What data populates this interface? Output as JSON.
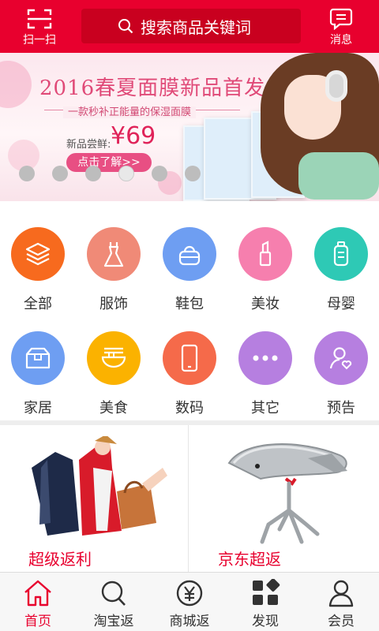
{
  "header": {
    "scan_label": "扫一扫",
    "search_placeholder": "搜索商品关键词",
    "message_label": "消息"
  },
  "banner": {
    "title": "2016春夏面膜新品首发",
    "subtitle": "一款秒补正能量的保湿面膜",
    "price_label": "新品尝鲜:",
    "price": "¥69",
    "cta": "点击了解>>",
    "slide_count": 6,
    "active_slide": 4
  },
  "categories": [
    {
      "label": "全部",
      "icon": "layers-icon",
      "color": "#f76a1e"
    },
    {
      "label": "服饰",
      "icon": "dress-icon",
      "color": "#f08a77"
    },
    {
      "label": "鞋包",
      "icon": "handbag-icon",
      "color": "#6e9ef2"
    },
    {
      "label": "美妆",
      "icon": "lipstick-icon",
      "color": "#f67fae"
    },
    {
      "label": "母婴",
      "icon": "bottle-icon",
      "color": "#2ec9b5"
    },
    {
      "label": "家居",
      "icon": "box-icon",
      "color": "#6e9ef2"
    },
    {
      "label": "美食",
      "icon": "noodle-bowl-icon",
      "color": "#fbb200"
    },
    {
      "label": "数码",
      "icon": "phone-icon",
      "color": "#f56a4a"
    },
    {
      "label": "其它",
      "icon": "more-dots-icon",
      "color": "#b67fe0"
    },
    {
      "label": "预告",
      "icon": "person-heart-icon",
      "color": "#b67fe0"
    }
  ],
  "promos": [
    {
      "title": "超级返利"
    },
    {
      "title": "京东超返"
    }
  ],
  "tabs": [
    {
      "label": "首页",
      "icon": "home-icon",
      "active": true
    },
    {
      "label": "淘宝返",
      "icon": "search-icon",
      "active": false
    },
    {
      "label": "商城返",
      "icon": "yen-coin-icon",
      "active": false
    },
    {
      "label": "发现",
      "icon": "grid-icon",
      "active": false
    },
    {
      "label": "会员",
      "icon": "person-icon",
      "active": false
    }
  ],
  "colors": {
    "brand": "#e8002e",
    "banner_accent": "#e04a78"
  }
}
